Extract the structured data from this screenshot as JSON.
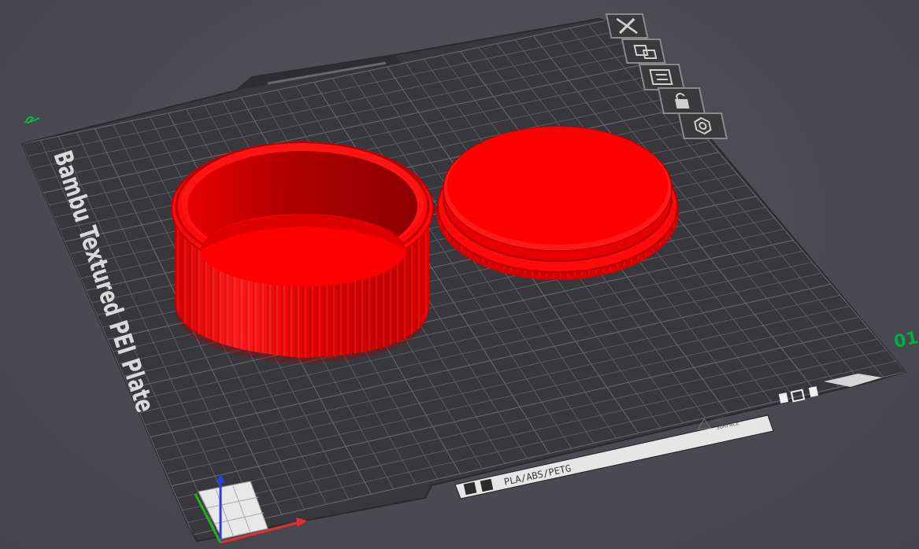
{
  "viewport": {
    "plate_name": "Bambu Textured PEI Plate",
    "plate_number": "01",
    "filament_label": "PLA/ABS/PETG",
    "warning_label_line1": "HOT",
    "warning_label_line2": "SURFACE"
  },
  "plate_toolbar": {
    "icons": [
      "close-icon",
      "arrange-icon",
      "orient-icon",
      "lock-icon",
      "settings-icon"
    ]
  },
  "colors": {
    "background": "#4b4b51",
    "plate": "#3a3a3e",
    "grid": "#5c5c62",
    "model": "#ff0000",
    "model_shadow": "#b40000",
    "axis_x": "#e03030",
    "axis_y": "#22b022",
    "axis_z": "#2a3ed8",
    "accent": "#00ae42"
  },
  "objects": [
    {
      "name": "container-body"
    },
    {
      "name": "container-lid"
    }
  ]
}
